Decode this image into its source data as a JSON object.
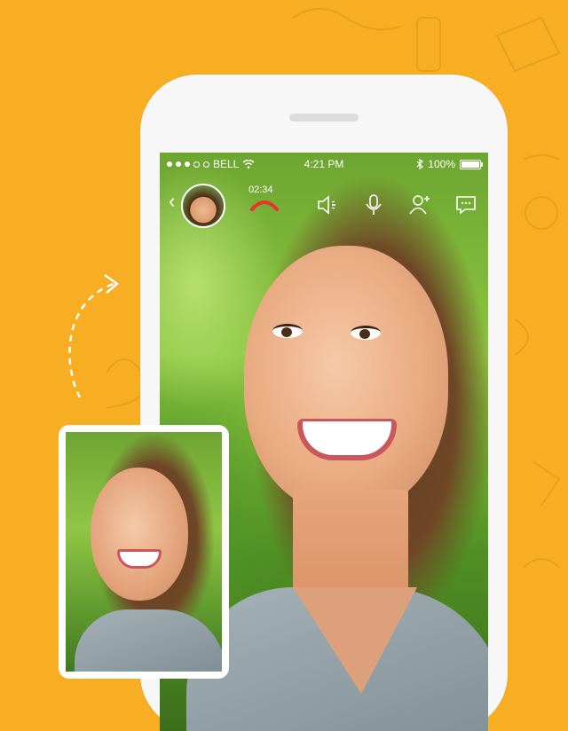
{
  "statusbar": {
    "carrier": "BELL",
    "time": "4:21 PM",
    "battery": "100%"
  },
  "call": {
    "duration": "02:34"
  },
  "colors": {
    "background": "#F7AE22",
    "hangup": "#E8332C",
    "phone_body": "#F7F7F7"
  },
  "toolbar": {
    "icons": [
      "back-icon",
      "caller-avatar",
      "hangup-icon",
      "speaker-icon",
      "microphone-icon",
      "add-user-icon",
      "chat-icon"
    ]
  }
}
